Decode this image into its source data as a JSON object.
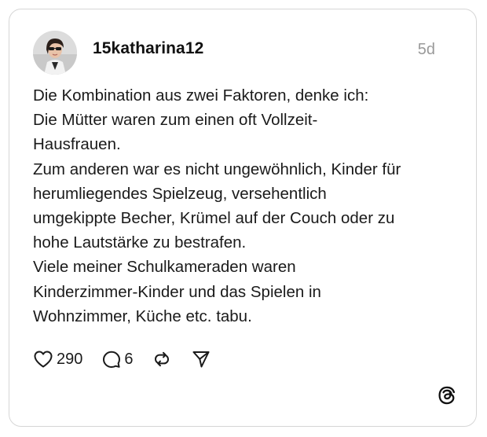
{
  "post": {
    "username": "15katharina12",
    "timestamp": "5d",
    "lines": [
      "Die Kombination aus zwei Faktoren, denke ich:",
      "Die Mütter waren zum einen oft Vollzeit-",
      "Hausfrauen.",
      "Zum anderen war es nicht ungewöhnlich, Kinder für",
      "herumliegendes Spielzeug, versehentlich",
      "umgekippte Becher, Krümel auf der Couch oder zu",
      "hohe Lautstärke zu bestrafen.",
      "Viele meiner Schulkameraden waren",
      "Kinderzimmer-Kinder und das Spielen in",
      "Wohnzimmer, Küche etc. tabu."
    ]
  },
  "actions": {
    "like_count": "290",
    "reply_count": "6"
  },
  "icons": {
    "like": "heart-icon",
    "reply": "speech-bubble-icon",
    "repost": "repost-icon",
    "share": "paper-plane-icon",
    "brand": "threads-logo-icon"
  },
  "colors": {
    "text": "#1a1a1a",
    "muted": "#9a9a9a",
    "border": "#d6d6d6"
  }
}
